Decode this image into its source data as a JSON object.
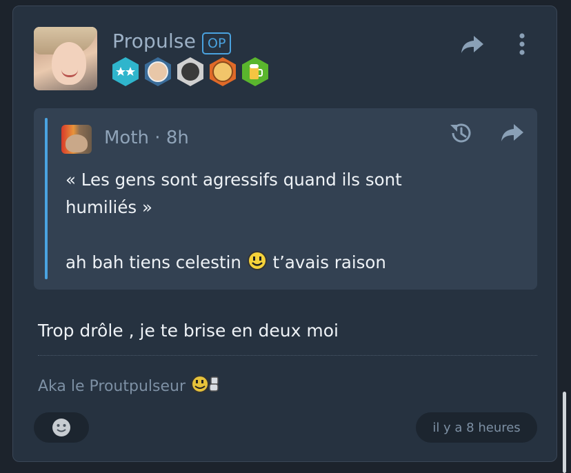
{
  "post": {
    "username": "Propulse",
    "op_badge": "OP",
    "badges": [
      "stars-badge",
      "grandpa-badge",
      "portrait-badge",
      "monkey-badge",
      "beer-badge"
    ],
    "reply_text": "Trop drôle , je te brise en deux moi",
    "signature": "Aka le Proutpulseur",
    "timestamp": "il y a 8 heures"
  },
  "quote": {
    "author": "Moth",
    "separator": "·",
    "time": "8h",
    "line1": "« Les gens sont agressifs quand ils sont",
    "line2": "humiliés »",
    "line3_before": "ah bah tiens celestin",
    "line3_after": "t’avais raison"
  },
  "colors": {
    "background": "#1c232c",
    "card": "#263240",
    "quote_bg": "#334152",
    "accent": "#4aa3e0",
    "text": "#eef2f6",
    "muted": "#7d90a4"
  },
  "icons": [
    "share-icon",
    "more-vertical-icon",
    "history-icon",
    "emoji-reaction-icon",
    "smiley-icon"
  ]
}
